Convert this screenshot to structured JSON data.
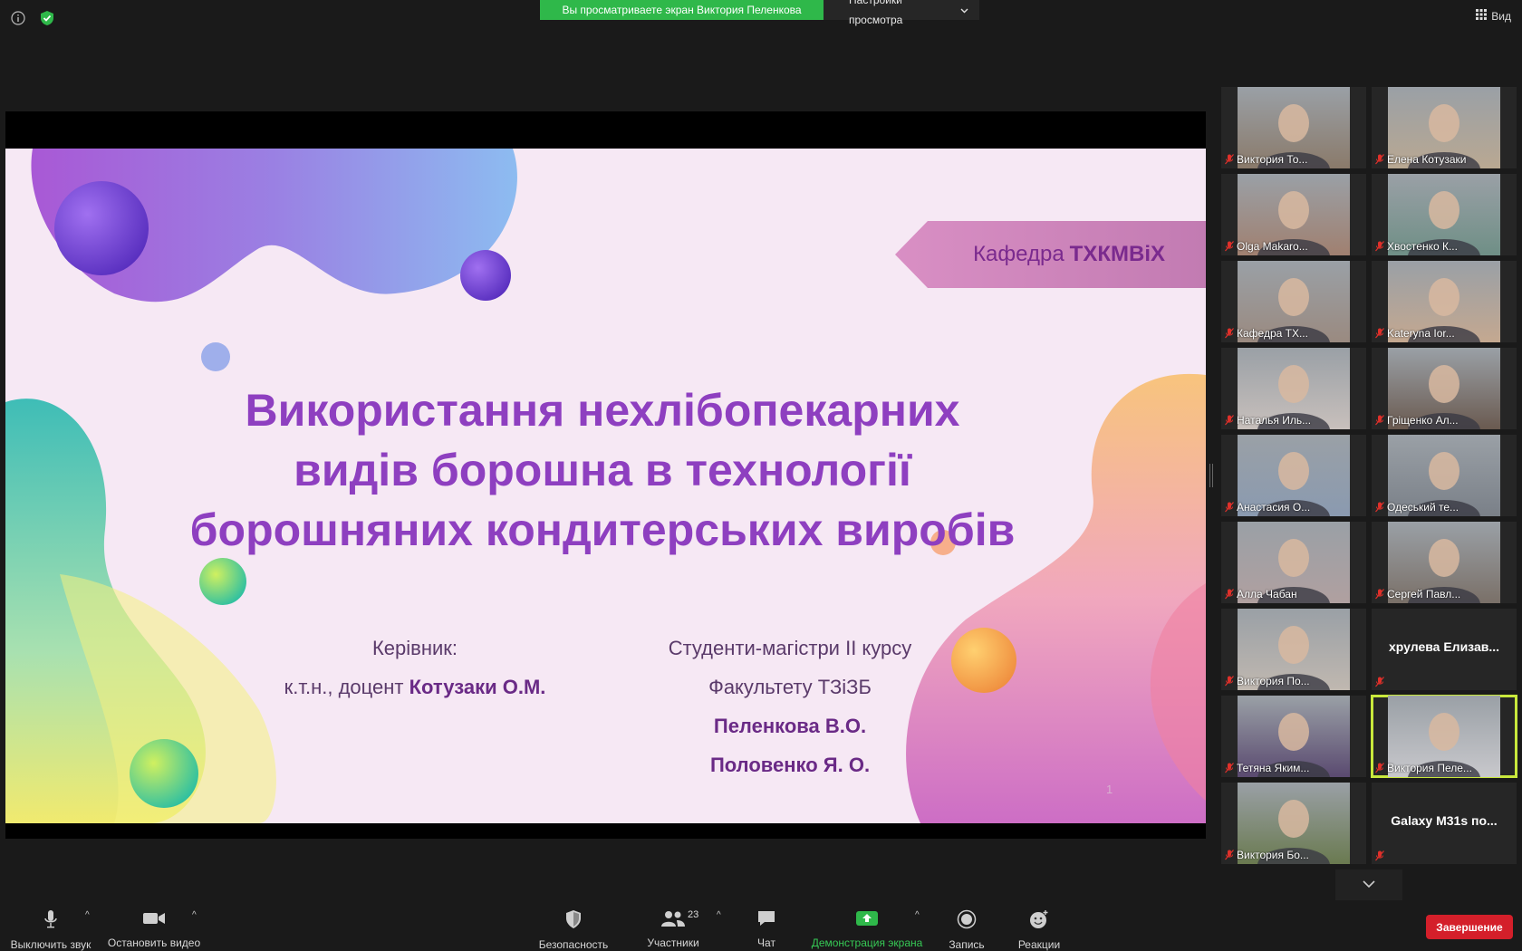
{
  "top": {
    "share_notice": "Вы просматриваете экран Виктория Пеленкова",
    "view_options": "Настройки просмотра",
    "view_label": "Вид",
    "accent_green": "#2fb84a"
  },
  "slide": {
    "dept_prefix": "Кафедра",
    "dept_bold": "ТХКМВіХ",
    "title_line1_a": "Використання",
    "title_line1_b": "нехлібопекарних",
    "title_line2": "видів борошна в технології",
    "title_line3": "борошняних кондитерських виробів",
    "supervisor_label": "Керівник:",
    "supervisor_prefix": "к.т.н., доцент",
    "supervisor_name": "Котузаки О.М.",
    "students_label": "Студенти-магістри ІІ курсу",
    "faculty": "Факультету ТЗіЗБ",
    "student1": "Пеленкова В.О.",
    "student2": "Половенко Я. О.",
    "page_number": "1"
  },
  "gallery": {
    "participants": [
      {
        "name": "Виктория То...",
        "video": true,
        "skin": "#8a7a6a"
      },
      {
        "name": "Елена Котузаки",
        "video": true,
        "skin": "#b9a892"
      },
      {
        "name": "Olga Makaro...",
        "video": true,
        "skin": "#a08070"
      },
      {
        "name": "Хвостенко К...",
        "video": true,
        "skin": "#6f8f86"
      },
      {
        "name": "Кафедра ТХ...",
        "video": true,
        "skin": "#9a8a80"
      },
      {
        "name": "Kateryna Ior...",
        "video": true,
        "skin": "#c4a890"
      },
      {
        "name": "Наталья Иль...",
        "video": true,
        "skin": "#c8c0bc"
      },
      {
        "name": "Грiщенко Ал...",
        "video": true,
        "skin": "#6a5a50"
      },
      {
        "name": "Анастасия О...",
        "video": true,
        "skin": "#8a9ab0"
      },
      {
        "name": "Одеський те...",
        "video": true,
        "skin": "#7a8088"
      },
      {
        "name": "Алла Чабан",
        "video": true,
        "skin": "#b0a0a0"
      },
      {
        "name": "Сергей Павл...",
        "video": true,
        "skin": "#7a7068"
      },
      {
        "name": "Виктория По...",
        "video": true,
        "skin": "#c0b8b0"
      },
      {
        "name": "хрулева Елизав...",
        "video": false
      },
      {
        "name": "Тетяна Яким...",
        "video": true,
        "skin": "#5a4a70"
      },
      {
        "name": "Виктория Пеле...",
        "video": true,
        "skin": "#c8c8cc",
        "active": true
      },
      {
        "name": "Виктория Бо...",
        "video": true,
        "skin": "#6a7a50"
      },
      {
        "name": "Galaxy M31s по...",
        "video": false
      }
    ]
  },
  "toolbar": {
    "mute": "Выключить звук",
    "stop_video": "Остановить видео",
    "security": "Безопасность",
    "participants": "Участники",
    "participants_count": "23",
    "chat": "Чат",
    "share_screen": "Демонстрация экрана",
    "record": "Запись",
    "reactions": "Реакции",
    "end": "Завершение",
    "end_color": "#d41f2a"
  }
}
